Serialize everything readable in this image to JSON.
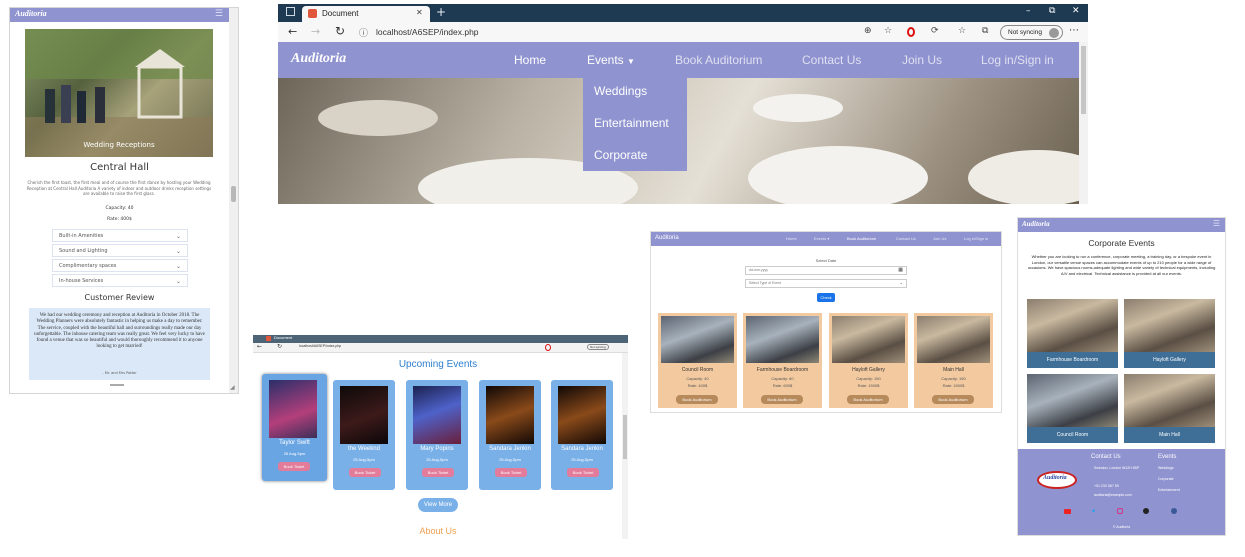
{
  "hall_panel": {
    "brand": "Auditoria",
    "hero_caption": "Wedding Receptions",
    "title": "Central Hall",
    "description": "Cherish the first toast, the first meal and of course the first dance by hosting your Wedding Reception at Central Hall.Auditoria A variety of indoor and outdoor drinks reception settings are available to raise the first glass.",
    "capacity": "Capacity: 40",
    "rate": "Rate: 400$",
    "accordion": [
      "Built-in Amenities",
      "Sound and Lighting",
      "Complimentary spaces",
      "In-house Services"
    ],
    "review_heading": "Customer Review",
    "review_text": "We had our wedding ceremony and reception at Auditoria in October 2018. The Wedding Planners were absolutely fantastic in helping us make a day to remember. The service, coupled with the beautiful hall and surroundings really made our day unforgettable. The inhouse catering team was really great. We feel very lucky to have found a venue that was so beautiful and would thoroughly recommend it to anyone looking to get married!",
    "review_author": "- Mr. and Mrs Potter"
  },
  "main_browser": {
    "tab_title": "Document",
    "url": "localhost/A6SEP/index.php",
    "sync_label": "Not syncing",
    "brand": "Auditoria",
    "nav": [
      "Home",
      "Events",
      "Book Auditorium",
      "Contact Us",
      "Join Us",
      "Log in/Sign in"
    ],
    "dropdown": [
      "Weddings",
      "Entertainment",
      "Corporate"
    ],
    "window_controls": {
      "minimize": "–",
      "restore": "⧉",
      "close": "✕"
    }
  },
  "events_browser": {
    "tab_title": "Document",
    "url": "localhost/A6SEP/index.php",
    "sync_label": "Not syncing",
    "heading": "Upcoming Events",
    "events": [
      {
        "name": "Taylor Swift",
        "date": "26 Aug-5pm",
        "button": "Book Ticket"
      },
      {
        "name": "the Weeknd",
        "date": "25 Aug-5pm",
        "button": "Book Ticket"
      },
      {
        "name": "Mary Popins",
        "date": "25 Aug-5pm",
        "button": "Book Ticket"
      },
      {
        "name": "Sandara Jenkin",
        "date": "25 Aug-5pm",
        "button": "Book Ticket"
      },
      {
        "name": "Sandara Jenkin",
        "date": "25 Aug-5pm",
        "button": "Book Ticket"
      }
    ],
    "view_more": "View More",
    "about_heading": "About Us"
  },
  "booking_panel": {
    "brand": "Auditoria",
    "nav": [
      "Home",
      "Events ▾",
      "Book Auditorium",
      "Contact Us",
      "Join Us",
      "Log in/Sign in"
    ],
    "select_date_label": "Select Date",
    "date_placeholder": "dd-mm-yyyy",
    "event_type_placeholder": "Select Type of Event",
    "check_button": "Check",
    "rooms": [
      {
        "name": "Council Room",
        "capacity": "Capacity: 40",
        "rate": "Rate: 400$",
        "button": "Book Auditorium"
      },
      {
        "name": "Farmhouse Boardroom",
        "capacity": "Capacity: 60",
        "rate": "Rate: 600$",
        "button": "Book Auditorium"
      },
      {
        "name": "Hayloft Gallery",
        "capacity": "Capacity: 150",
        "rate": "Rate: 1500$",
        "button": "Book Auditorium"
      },
      {
        "name": "Main Hall",
        "capacity": "Capacity: 150",
        "rate": "Rate: 1500$",
        "button": "Book Auditorium"
      }
    ]
  },
  "corporate_panel": {
    "brand": "Auditoria",
    "title": "Corporate Events",
    "description": "Whether you are looking to run a conference, corporate meeting, a training day, or a bespoke event in London, our versatile venue spaces can accommodate events of up to 210 people for a wide range of occasions. We have spacious rooms,adequate lighting and wide variety of technical equipments, including A/V and electrical. Technical assistance is provided at all our events.",
    "rooms": [
      "Farmhouse Boardroom",
      "Hayloft Gallery",
      "Council Room",
      "Main Hall"
    ],
    "footer": {
      "contact_heading": "Contact Us",
      "events_heading": "Events",
      "address": "Swindon, London W12H 8SP",
      "phone": "+91 23X 567 89",
      "email": "auditoria@example.com",
      "event_links": [
        "Weddings",
        "Corporate",
        "Entertainment"
      ],
      "logo_text": "Auditoria",
      "copyright": "© Auditoria"
    }
  },
  "colors": {
    "nav_purple": "#8f93cf",
    "accent_blue": "#1a73e8",
    "event_card": "#7ab0e8",
    "book_ticket": "#e27c9a",
    "room_card": "#f3caa0",
    "corp_caption": "#3f6f97",
    "title_blue": "#2f7fcf",
    "about_orange": "#f0a050"
  },
  "icons": [
    "menu-icon",
    "back-icon",
    "forward-icon",
    "refresh-icon",
    "info-icon",
    "zoom-icon",
    "favorite-icon",
    "opera-icon",
    "extensions-icon",
    "collections-icon",
    "profile-icon",
    "more-icon",
    "calendar-icon",
    "chevron-down-icon",
    "youtube-icon",
    "twitter-icon",
    "instagram-icon",
    "github-icon",
    "facebook-icon"
  ]
}
